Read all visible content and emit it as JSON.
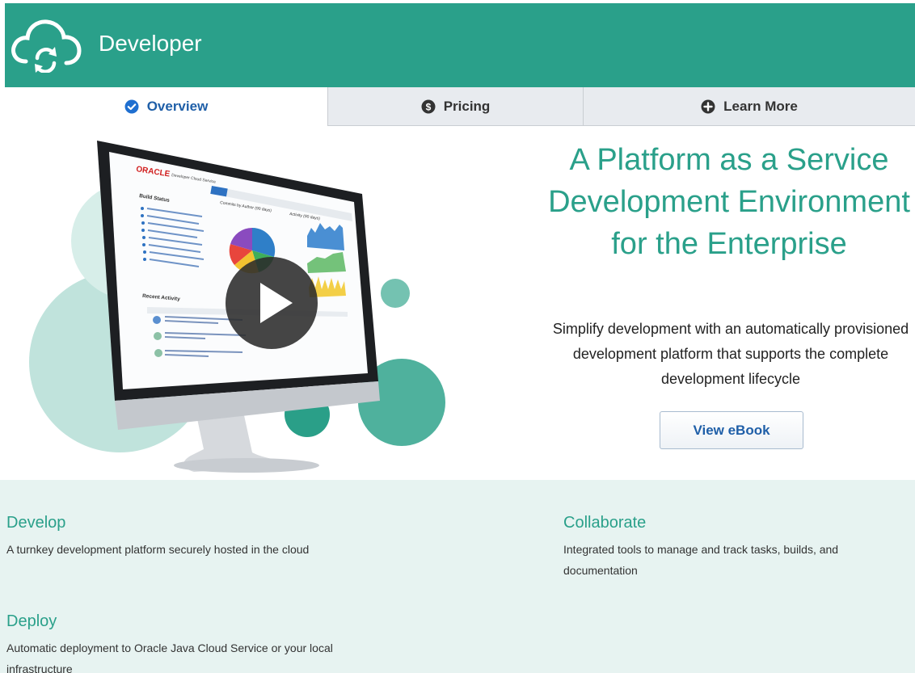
{
  "header": {
    "title": "Developer",
    "brand_color": "#2aa08a"
  },
  "tabs": [
    {
      "label": "Overview",
      "icon": "check-circle-icon",
      "active": true
    },
    {
      "label": "Pricing",
      "icon": "dollar-circle-icon",
      "active": false
    },
    {
      "label": "Learn More",
      "icon": "plus-circle-icon",
      "active": false
    }
  ],
  "hero": {
    "title": "A Platform as a Service Development Environment for the Enterprise",
    "description": "Simplify development with an automatically provisioned development platform that supports the complete development lifecycle",
    "cta_label": "View eBook",
    "video_icon": "play-icon",
    "screen": {
      "brand": "ORACLE",
      "product": "Developer Cloud Service",
      "panel_left": "Build Status",
      "panel_middle": "Commits by Author (90 days)",
      "panel_right": "Activity (90 days)",
      "recent_activity": "Recent Activity"
    }
  },
  "features": [
    {
      "title": "Develop",
      "text": "A turnkey development platform securely hosted in the cloud"
    },
    {
      "title": "Collaborate",
      "text": "Integrated tools to manage and track tasks, builds, and documentation"
    },
    {
      "title": "Deploy",
      "text": "Automatic deployment to Oracle Java Cloud Service or your local infrastructure"
    }
  ]
}
